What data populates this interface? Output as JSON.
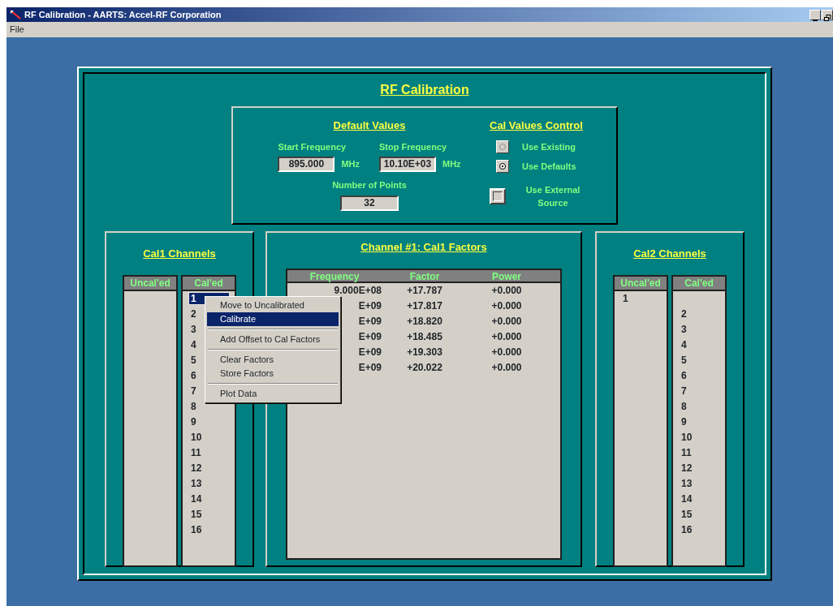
{
  "window": {
    "title": "RF Calibration - AARTS: Accel-RF Corporation"
  },
  "menu_bar": [
    "File"
  ],
  "heading": "RF Calibration",
  "defaults": {
    "title": "Default Values",
    "start_frequency": {
      "label": "Start Frequency",
      "value": "895.000",
      "unit": "MHz"
    },
    "stop_frequency": {
      "label": "Stop Frequency",
      "value": "10.10E+03",
      "unit": "MHz"
    },
    "number_of_points": {
      "label": "Number of Points",
      "value": "32"
    }
  },
  "cal_values_control": {
    "title": "Cal Values Control",
    "options": [
      {
        "label": "Use Existing",
        "selected": false
      },
      {
        "label": "Use Defaults",
        "selected": true
      }
    ],
    "external_source": {
      "label": "Use External Source",
      "checked": false
    }
  },
  "cal1_channels": {
    "title": "Cal1 Channels",
    "uncaled": {
      "header": "Uncal'ed"
    },
    "caled": {
      "header": "Cal'ed",
      "leading_gap": false,
      "items": [
        {
          "label": "1",
          "selected": true
        },
        {
          "label": "2",
          "selected": false
        },
        {
          "label": "3",
          "selected": false
        },
        {
          "label": "4",
          "selected": false
        },
        {
          "label": "5",
          "selected": false
        },
        {
          "label": "6",
          "selected": false
        },
        {
          "label": "7",
          "selected": false
        },
        {
          "label": "8",
          "selected": false
        },
        {
          "label": "9",
          "selected": false
        },
        {
          "label": "10",
          "selected": false
        },
        {
          "label": "11",
          "selected": false
        },
        {
          "label": "12",
          "selected": false
        },
        {
          "label": "13",
          "selected": false
        },
        {
          "label": "14",
          "selected": false
        },
        {
          "label": "15",
          "selected": false
        },
        {
          "label": "16",
          "selected": false
        }
      ]
    }
  },
  "factors": {
    "title": "Channel #1: Cal1 Factors",
    "columns": [
      "Frequency",
      "Factor",
      "Power"
    ],
    "rows": [
      [
        "9.000E+08",
        "+17.787",
        "+0.000"
      ],
      [
        "E+09",
        "+17.817",
        "+0.000"
      ],
      [
        "E+09",
        "+18.820",
        "+0.000"
      ],
      [
        "E+09",
        "+18.485",
        "+0.000"
      ],
      [
        "E+09",
        "+19.303",
        "+0.000"
      ],
      [
        "E+09",
        "+20.022",
        "+0.000"
      ]
    ]
  },
  "cal2_channels": {
    "title": "Cal2 Channels",
    "uncaled": {
      "header": "Uncal'ed",
      "items": [
        {
          "label": "1",
          "selected": false
        }
      ]
    },
    "caled": {
      "header": "Cal'ed",
      "leading_gap": true,
      "items": [
        {
          "label": "2",
          "selected": false
        },
        {
          "label": "3",
          "selected": false
        },
        {
          "label": "4",
          "selected": false
        },
        {
          "label": "5",
          "selected": false
        },
        {
          "label": "6",
          "selected": false
        },
        {
          "label": "7",
          "selected": false
        },
        {
          "label": "8",
          "selected": false
        },
        {
          "label": "9",
          "selected": false
        },
        {
          "label": "10",
          "selected": false
        },
        {
          "label": "11",
          "selected": false
        },
        {
          "label": "12",
          "selected": false
        },
        {
          "label": "13",
          "selected": false
        },
        {
          "label": "14",
          "selected": false
        },
        {
          "label": "15",
          "selected": false
        },
        {
          "label": "16",
          "selected": false
        }
      ]
    }
  },
  "context_menu": [
    {
      "kind": "item",
      "label": "Move to Uncalibrated",
      "selected": false
    },
    {
      "kind": "item",
      "label": "Calibrate",
      "selected": true
    },
    {
      "kind": "separator"
    },
    {
      "kind": "item",
      "label": "Add Offset to Cal Factors",
      "selected": false
    },
    {
      "kind": "separator"
    },
    {
      "kind": "item",
      "label": "Clear Factors",
      "selected": false
    },
    {
      "kind": "item",
      "label": "Store Factors",
      "selected": false
    },
    {
      "kind": "separator"
    },
    {
      "kind": "item",
      "label": "Plot Data",
      "selected": false
    }
  ]
}
